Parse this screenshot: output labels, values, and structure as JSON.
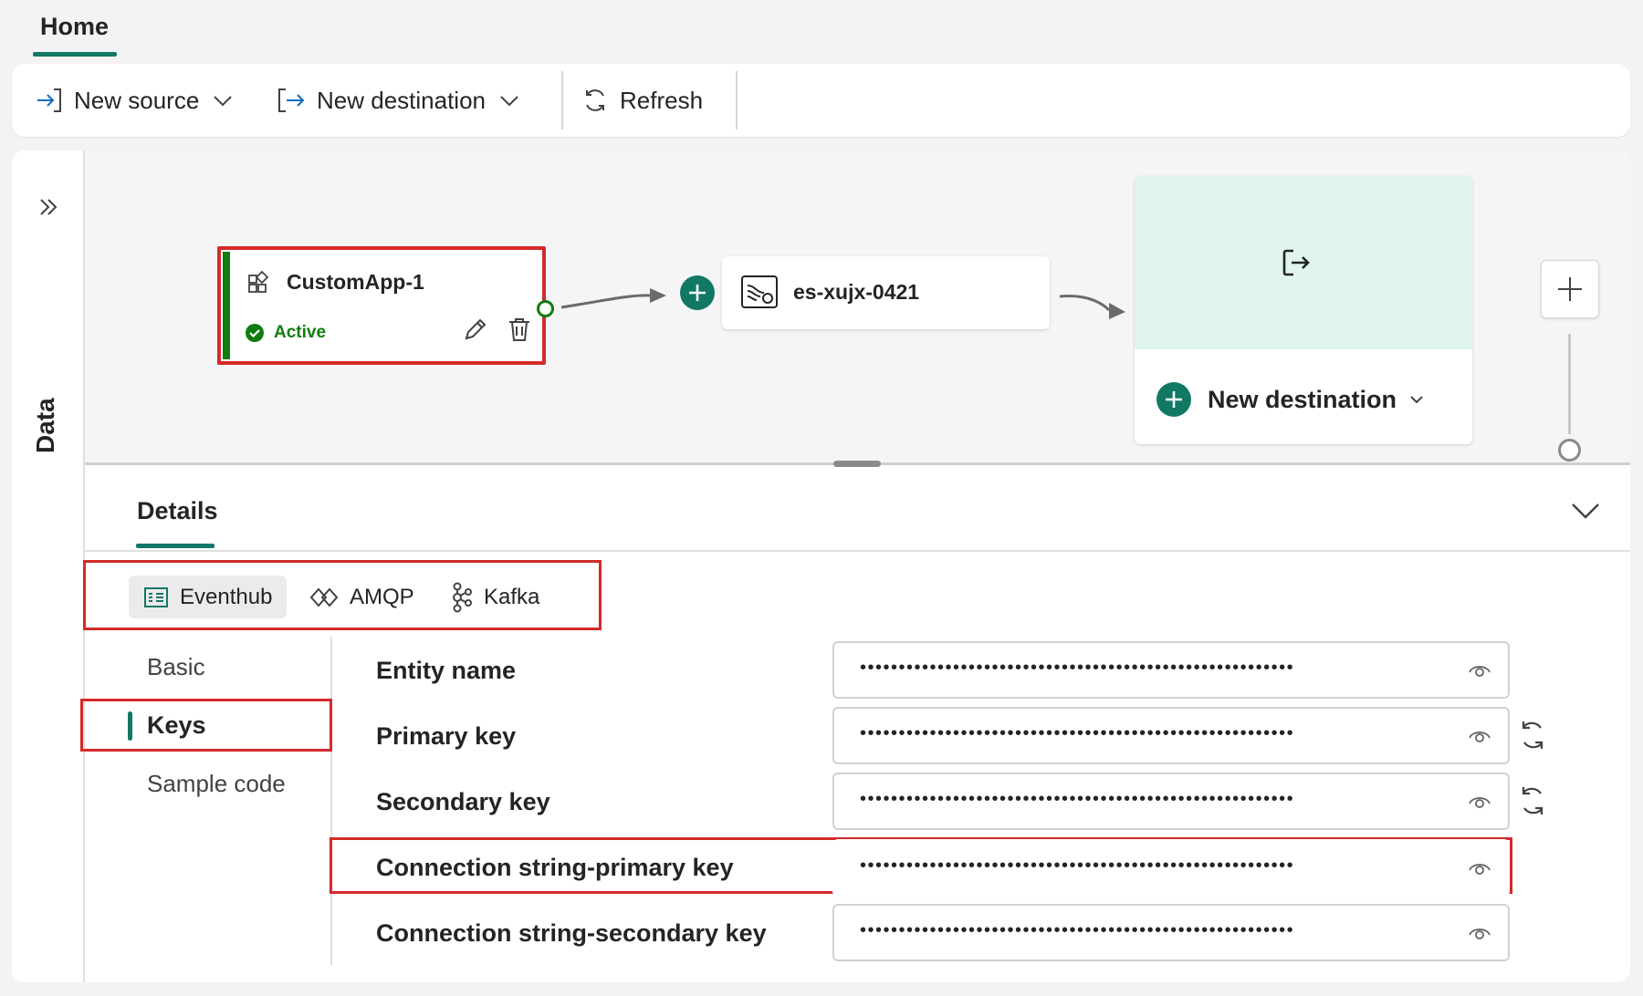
{
  "tabs": {
    "home": "Home"
  },
  "toolbar": {
    "new_source": "New source",
    "new_destination": "New destination",
    "refresh": "Refresh"
  },
  "side_rail": {
    "label": "Data"
  },
  "canvas": {
    "source_node": {
      "title": "CustomApp-1",
      "status": "Active"
    },
    "stream_node": {
      "title": "es-xujx-0421"
    },
    "destination_node": {
      "label": "New destination"
    }
  },
  "details": {
    "tab_label": "Details",
    "protocols": [
      {
        "label": "Eventhub",
        "active": true,
        "icon": "eventhub-icon"
      },
      {
        "label": "AMQP",
        "active": false,
        "icon": "amqp-icon"
      },
      {
        "label": "Kafka",
        "active": false,
        "icon": "kafka-icon"
      }
    ],
    "nav": {
      "basic": "Basic",
      "keys": "Keys",
      "sample_code": "Sample code"
    },
    "fields": [
      {
        "label": "Entity name",
        "value": "••••••••••••••••••••••••••••••••••••••••••••••••••••••••",
        "regenerate": false
      },
      {
        "label": "Primary key",
        "value": "••••••••••••••••••••••••••••••••••••••••••••••••••••••••",
        "regenerate": true
      },
      {
        "label": "Secondary key",
        "value": "••••••••••••••••••••••••••••••••••••••••••••••••••••••••",
        "regenerate": true
      },
      {
        "label": "Connection string-primary key",
        "value": "••••••••••••••••••••••••••••••••••••••••••••••••••••••••",
        "regenerate": false
      },
      {
        "label": "Connection string-secondary key",
        "value": "••••••••••••••••••••••••••••••••••••••••••••••••••••••••",
        "regenerate": false
      }
    ]
  },
  "colors": {
    "accent": "#117865",
    "active_green": "#107c10",
    "highlight_red": "#d42a2a",
    "dest_bg": "#e0f5ec"
  }
}
